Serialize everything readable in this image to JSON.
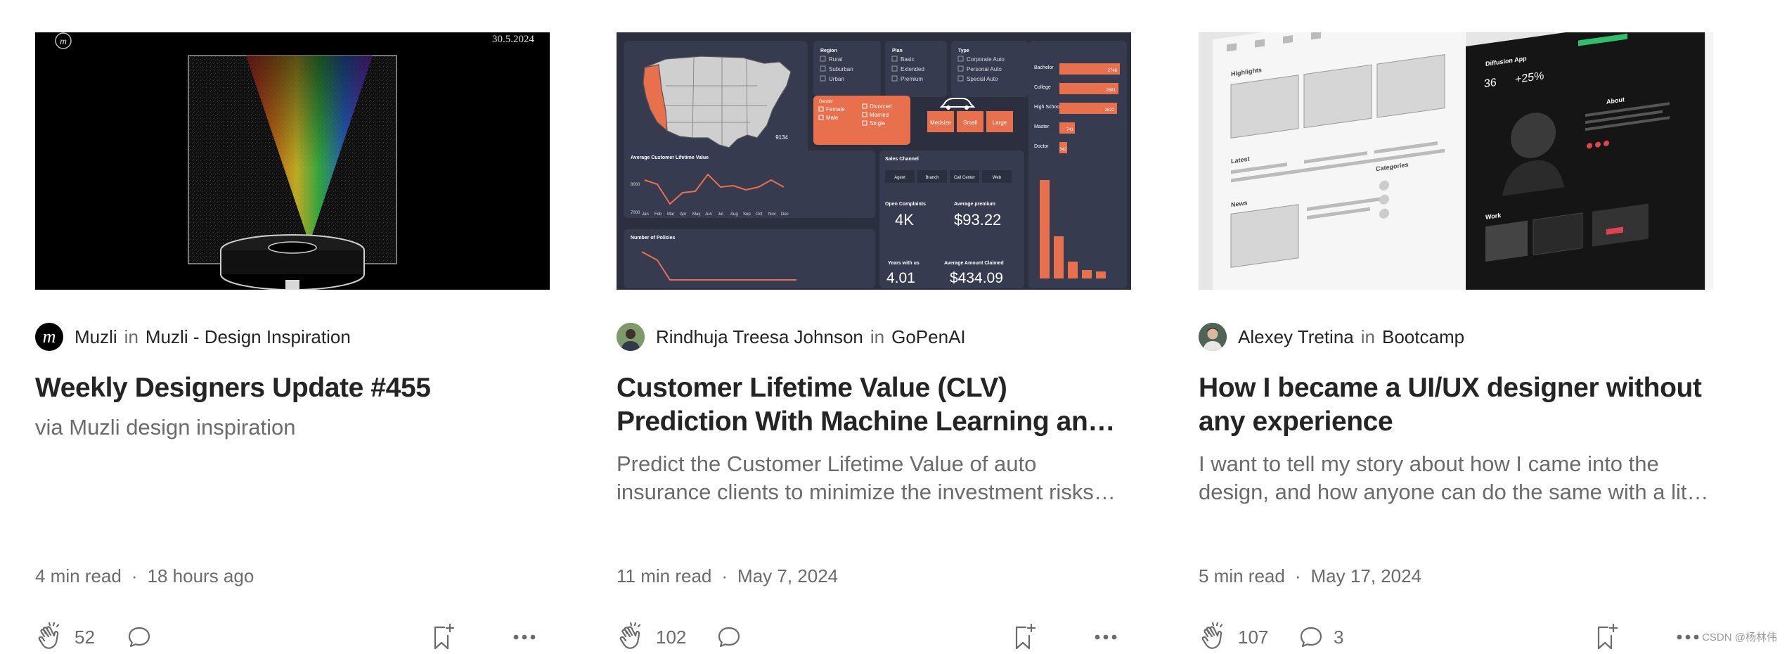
{
  "cards": [
    {
      "thumb": {
        "logo_letter": "m",
        "date": "30.5.2024"
      },
      "author": "Muzli",
      "in_label": "in",
      "publication": "Muzli - Design Inspiration",
      "title": "Weekly Designers Update #455",
      "subtitle": "via Muzli design inspiration",
      "read_time": "4 min read",
      "separator": "·",
      "date": "18 hours ago",
      "claps": "52",
      "comments": ""
    },
    {
      "thumb": {
        "region_label": "Region",
        "region_options": [
          "Rural",
          "Suburban",
          "Urban"
        ],
        "plan_label": "Plan",
        "plan_options": [
          "Basic",
          "Extended",
          "Premium"
        ],
        "type_label": "Type",
        "type_options": [
          "Corporate Auto",
          "Personal Auto",
          "Special Auto"
        ],
        "edu_labels": [
          "Bachelor",
          "College",
          "High School",
          "Master",
          "Doctor"
        ],
        "edu_values": [
          "2748",
          "2681",
          "2622",
          "741",
          "342"
        ],
        "map_count": "9134",
        "gender_label": "Gender",
        "gender_options": [
          "Female",
          "Male"
        ],
        "marital_options": [
          "Divorced",
          "Married",
          "Single"
        ],
        "size_options": [
          "Medsize",
          "Small",
          "Large"
        ],
        "clv_title": "Average Customer Lifetime Value",
        "months": [
          "Jan",
          "Feb",
          "Mar",
          "Apr",
          "May",
          "Jun",
          "Jul",
          "Aug",
          "Sep",
          "Oct",
          "Nov",
          "Dec"
        ],
        "clv_ticks": [
          "8000",
          "7000"
        ],
        "policies_title": "Number of Policies",
        "sales_title": "Sales Channel",
        "sales_options": [
          "Agent",
          "Branch",
          "Call Center",
          "Web"
        ],
        "open_complaints_label": "Open Complaints",
        "open_complaints": "4K",
        "avg_premium_label": "Average premium",
        "avg_premium": "$93.22",
        "years_label": "Years with us",
        "years": "4.01",
        "avg_claimed_label": "Average Amount Claimed",
        "avg_claimed": "$434.09"
      },
      "author": "Rindhuja Treesa Johnson",
      "in_label": "in",
      "publication": "GoPenAI",
      "title": "Customer Lifetime Value (CLV) Prediction With Machine Learning and Power BI",
      "subtitle": "Predict the Customer Lifetime Value of auto insurance clients to minimize the investment risks and maximize returns",
      "read_time": "11 min read",
      "separator": "·",
      "date": "May 7, 2024",
      "claps": "102",
      "comments": ""
    },
    {
      "thumb": {
        "highlights": "Highlights",
        "latest": "Latest",
        "news": "News",
        "categories": "Categories",
        "app_name": "Diffusion App",
        "stat1": "36",
        "stat2": "+25%",
        "about": "About",
        "work": "Work"
      },
      "author": "Alexey Tretina",
      "in_label": "in",
      "publication": "Bootcamp",
      "title": "How I became a UI/UX designer without any experience",
      "subtitle": "I want to tell my story about how I came into the design, and how anyone can do the same with a little effort",
      "read_time": "5 min read",
      "separator": "·",
      "date": "May 17, 2024",
      "claps": "107",
      "comments": "3"
    }
  ],
  "icons": {
    "clap": "clap-icon",
    "comment": "comment-icon",
    "bookmark": "bookmark-add-icon",
    "more": "more-icon"
  },
  "colors": {
    "accent": "#e8704d",
    "dashboard_bg": "#2b2f3f",
    "text": "#242424",
    "muted": "#6b6b6b"
  },
  "watermark": "CSDN @杨林伟"
}
